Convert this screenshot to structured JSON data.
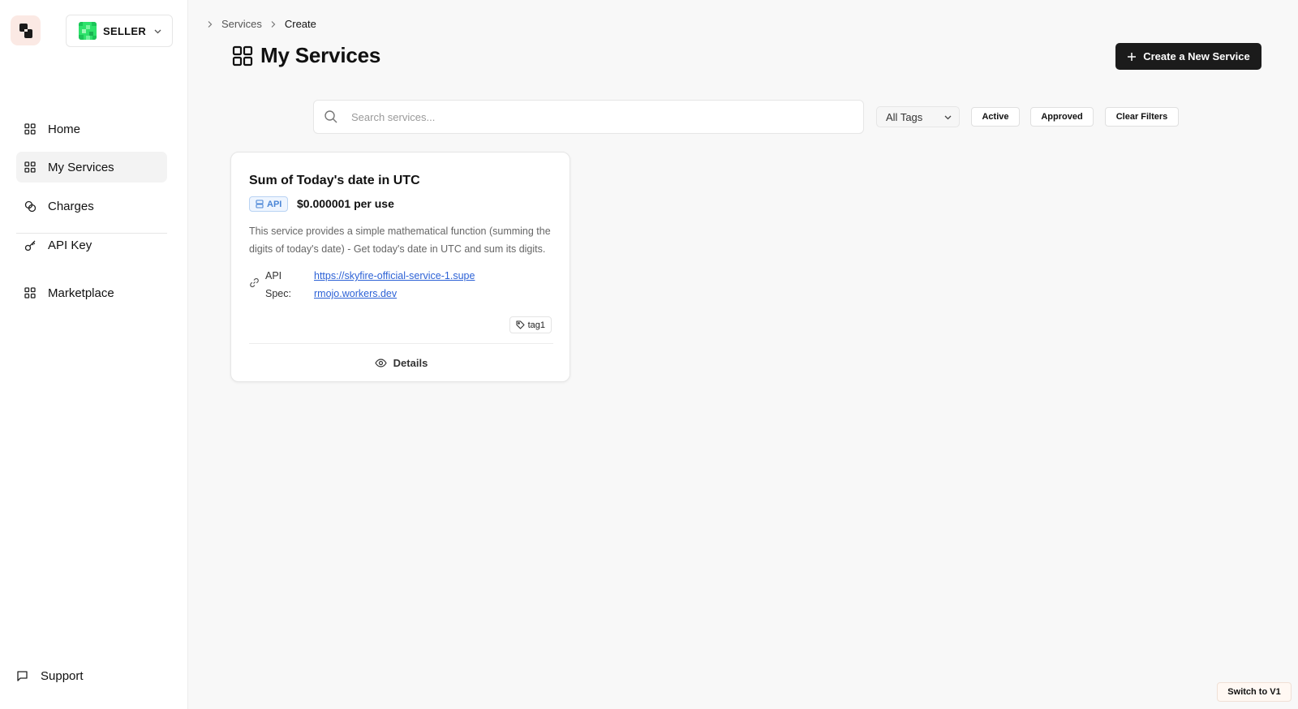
{
  "sidebar": {
    "role": {
      "label": "SELLER"
    },
    "items": [
      {
        "label": "Home",
        "icon": "grid-icon",
        "active": false
      },
      {
        "label": "My Services",
        "icon": "grid-icon",
        "active": true
      },
      {
        "label": "Charges",
        "icon": "coins-icon",
        "active": false
      },
      {
        "label": "API Key",
        "icon": "key-icon",
        "active": false
      },
      {
        "label": "Marketplace",
        "icon": "grid-icon",
        "active": false
      }
    ],
    "support": {
      "label": "Support",
      "icon": "message-icon"
    }
  },
  "breadcrumb": {
    "items": [
      "Services",
      "Create"
    ]
  },
  "header": {
    "title": "My Services",
    "create_button": "Create a New Service"
  },
  "filters": {
    "search_placeholder": "Search services...",
    "tags_select": "All Tags",
    "active": "Active",
    "approved": "Approved",
    "clear": "Clear Filters"
  },
  "services": [
    {
      "title": "Sum of Today's date in UTC",
      "type": "API",
      "price": "$0.000001 per use",
      "description": "This service provides a simple mathematical function (summing the digits of today's date) - Get today's date in UTC and sum its digits.",
      "spec_label": "API Spec:",
      "spec_url": "https://skyfire-official-service-1.supermojo.workers.dev",
      "tag": "tag1",
      "details": "Details"
    }
  ],
  "footer": {
    "switch_label": "Switch to V1"
  },
  "colors": {
    "accent_dark": "#1b1b1b",
    "link": "#2d62d6",
    "badge_blue": "#4a85d6",
    "avatar_green": "#2ee26b"
  }
}
